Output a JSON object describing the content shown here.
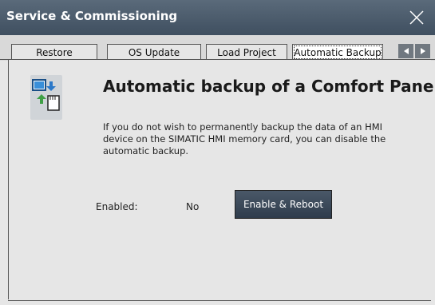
{
  "window": {
    "title": "Service & Commissioning"
  },
  "tabs": [
    {
      "label": "Restore",
      "active": false
    },
    {
      "label": "OS Update",
      "active": false
    },
    {
      "label": "Load Project",
      "active": false
    },
    {
      "label": "Automatic Backup",
      "active": true
    }
  ],
  "content": {
    "heading": "Automatic backup of a Comfort Panel",
    "description": "If you do not wish to permanently backup the data of an HMI device on the SIMATIC HMI memory card, you can disable the automatic backup.",
    "enabled_label": "Enabled:",
    "enabled_value": "No",
    "enable_button": "Enable & Reboot"
  },
  "icons": {
    "close": "close-icon",
    "left": "arrow-left-icon",
    "right": "arrow-right-icon",
    "backup": "backup-icon"
  },
  "colors": {
    "titlebar": "#4a5a6b",
    "button": "#3b4858",
    "content_bg": "#e6e6e6"
  }
}
